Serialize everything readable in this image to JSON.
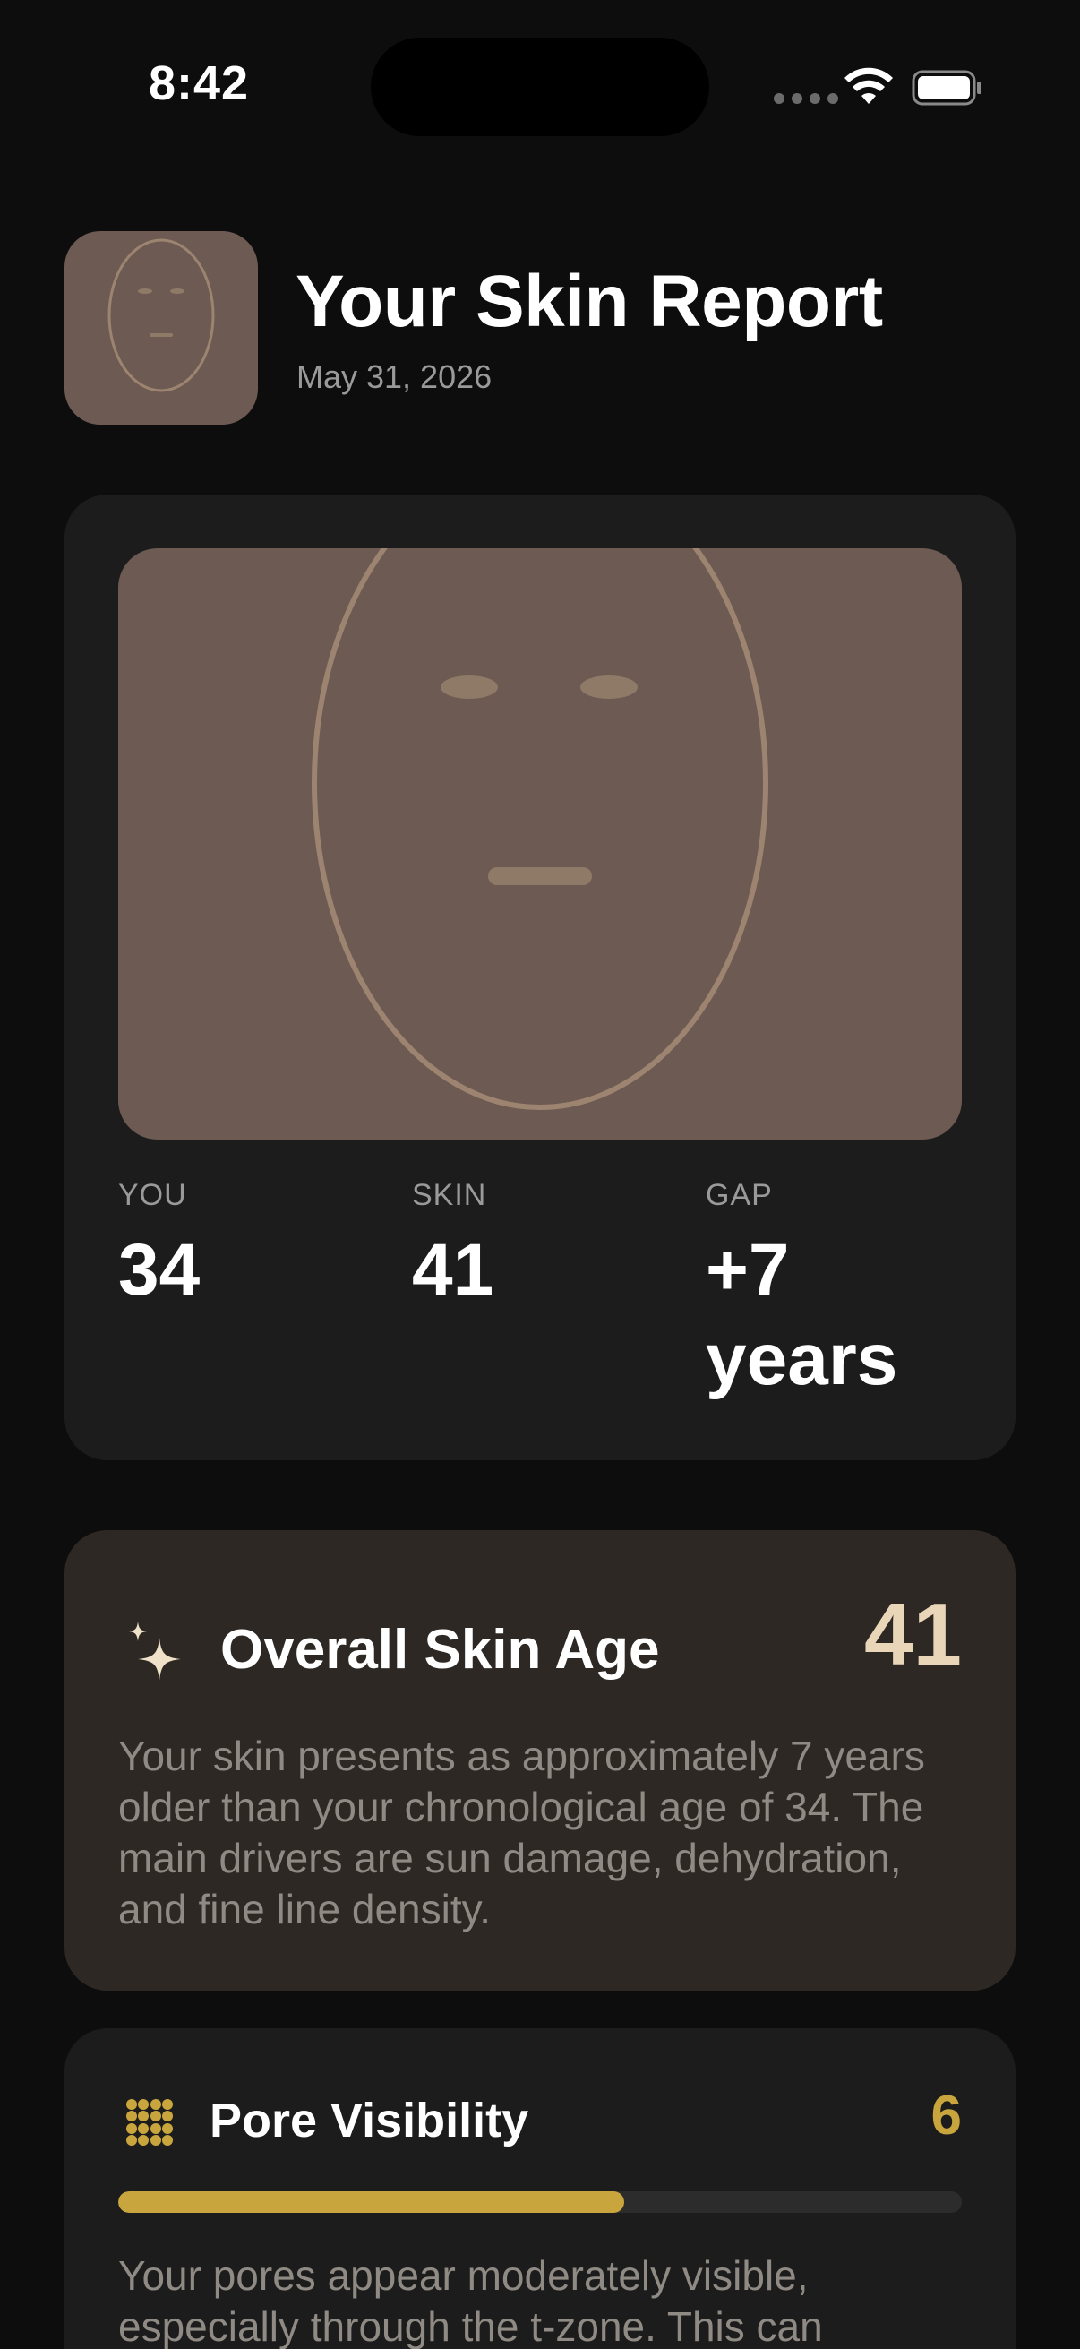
{
  "status_bar": {
    "time": "8:42"
  },
  "header": {
    "title": "Your Skin Report",
    "date": "May 31, 2026"
  },
  "age_card": {
    "stats": [
      {
        "label": "YOU",
        "value": "34"
      },
      {
        "label": "SKIN",
        "value": "41"
      },
      {
        "label": "GAP",
        "value": "+7 years"
      }
    ]
  },
  "overall_card": {
    "icon": "sparkle-icon",
    "title": "Overall Skin Age",
    "score": "41",
    "description": "Your skin presents as approximately 7 years older than your chronological age of 34. The main drivers are sun damage, dehydration, and fine line density."
  },
  "pore_card": {
    "icon": "grid-dots-icon",
    "title": "Pore Visibility",
    "score": "6",
    "progress": 0.6,
    "description": "Your pores appear moderately visible, especially through the t-zone. This can"
  },
  "colors": {
    "background": "#0d0d0d",
    "card": "#1c1c1c",
    "card_gold": "#2d2823",
    "accent_gold": "#c9a53d",
    "score_cream": "#e9d6b8",
    "face_tone": "#6d5a52"
  }
}
